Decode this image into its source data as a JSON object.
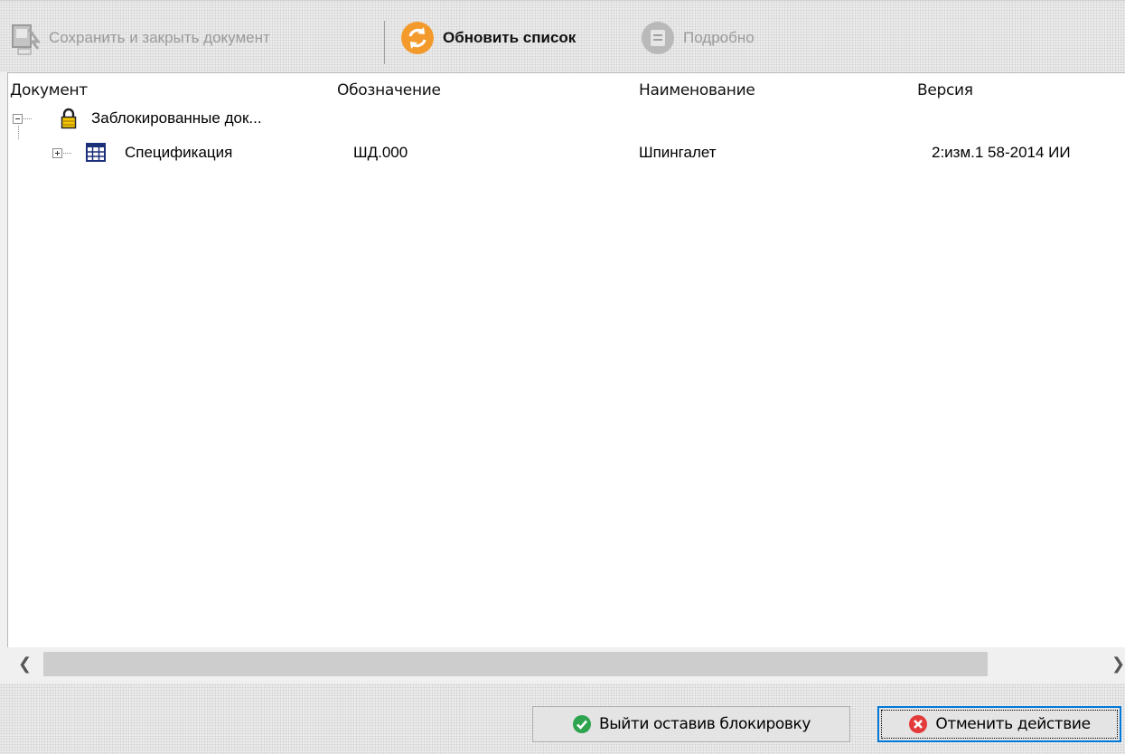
{
  "toolbar": {
    "save_close_label": "Сохранить и закрыть документ",
    "refresh_label": "Обновить список",
    "details_label": "Подробно"
  },
  "columns": [
    "Документ",
    "Обозначение",
    "Наименование",
    "Версия"
  ],
  "tree": {
    "group": {
      "label": "Заблокированные док...",
      "icon": "lock-icon",
      "expanded": true
    },
    "items": [
      {
        "label": "Спецификация",
        "icon": "table-icon",
        "designation": "ШД.000",
        "name": "Шпингалет",
        "version": "2:изм.1 58-2014 ИИ"
      }
    ]
  },
  "buttons": {
    "exit_keep_lock": "Выйти оставив блокировку",
    "cancel_action": "Отменить действие"
  },
  "colors": {
    "refresh_orange": "#f39a2c",
    "ok_green": "#2ea44f",
    "cancel_red": "#e33b3b",
    "focus_blue": "#0078d7",
    "lock_yellow": "#f2c500"
  }
}
